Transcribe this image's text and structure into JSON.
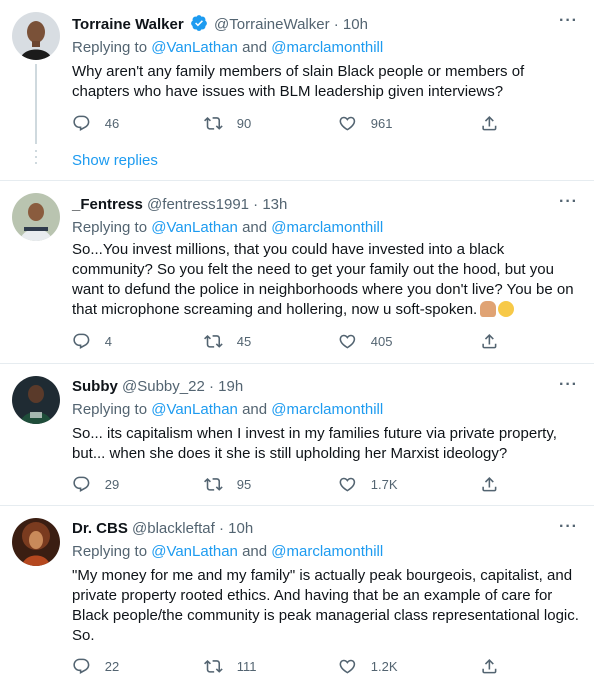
{
  "colors": {
    "accent": "#1d9bf0",
    "muted": "#536471",
    "text": "#0f1419",
    "border": "#e6ecf0"
  },
  "tweets": [
    {
      "name": "Torraine Walker",
      "handle": "@TorraineWalker",
      "time": "· 10h",
      "verified": true,
      "replying_label": "Replying to",
      "mention1": "@VanLathan",
      "and_label": "and",
      "mention2": "@marclamonthill",
      "text": "Why aren't any family members of slain Black people or members of chapters who have issues with BLM leadership given interviews?",
      "replies": "46",
      "retweets": "90",
      "likes": "961"
    },
    {
      "name": "_Fentress",
      "handle": "@fentress1991",
      "time": "· 13h",
      "replying_label": "Replying to",
      "mention1": "@VanLathan",
      "and_label": "and",
      "mention2": "@marclamonthill",
      "text": "So...You invest millions, that you could have invested into a black community? So you felt the need to get your family out the hood, but you want to defund the police in neighborhoods where you don't live? You be on that microphone screaming and hollering, now u soft-spoken.",
      "emojis": [
        "person-shrugging",
        "pleading-face"
      ],
      "replies": "4",
      "retweets": "45",
      "likes": "405"
    },
    {
      "name": "Subby",
      "handle": "@Subby_22",
      "time": "· 19h",
      "replying_label": "Replying to",
      "mention1": "@VanLathan",
      "and_label": "and",
      "mention2": "@marclamonthill",
      "text": "So... its capitalism when I invest in my families future via private property, but... when she does it she is still upholding her Marxist ideology?",
      "replies": "29",
      "retweets": "95",
      "likes": "1.7K"
    },
    {
      "name": "Dr. CBS",
      "handle": "@blackleftaf",
      "time": "· 10h",
      "replying_label": "Replying to",
      "mention1": "@VanLathan",
      "and_label": "and",
      "mention2": "@marclamonthill",
      "text": "\"My money for me and my family\" is actually peak bourgeois, capitalist, and private property rooted ethics. And having that be an example of care for Black people/the community is peak managerial class representational logic. So.",
      "replies": "22",
      "retweets": "111",
      "likes": "1.2K"
    }
  ],
  "show_replies": "Show replies",
  "more_label": "···"
}
